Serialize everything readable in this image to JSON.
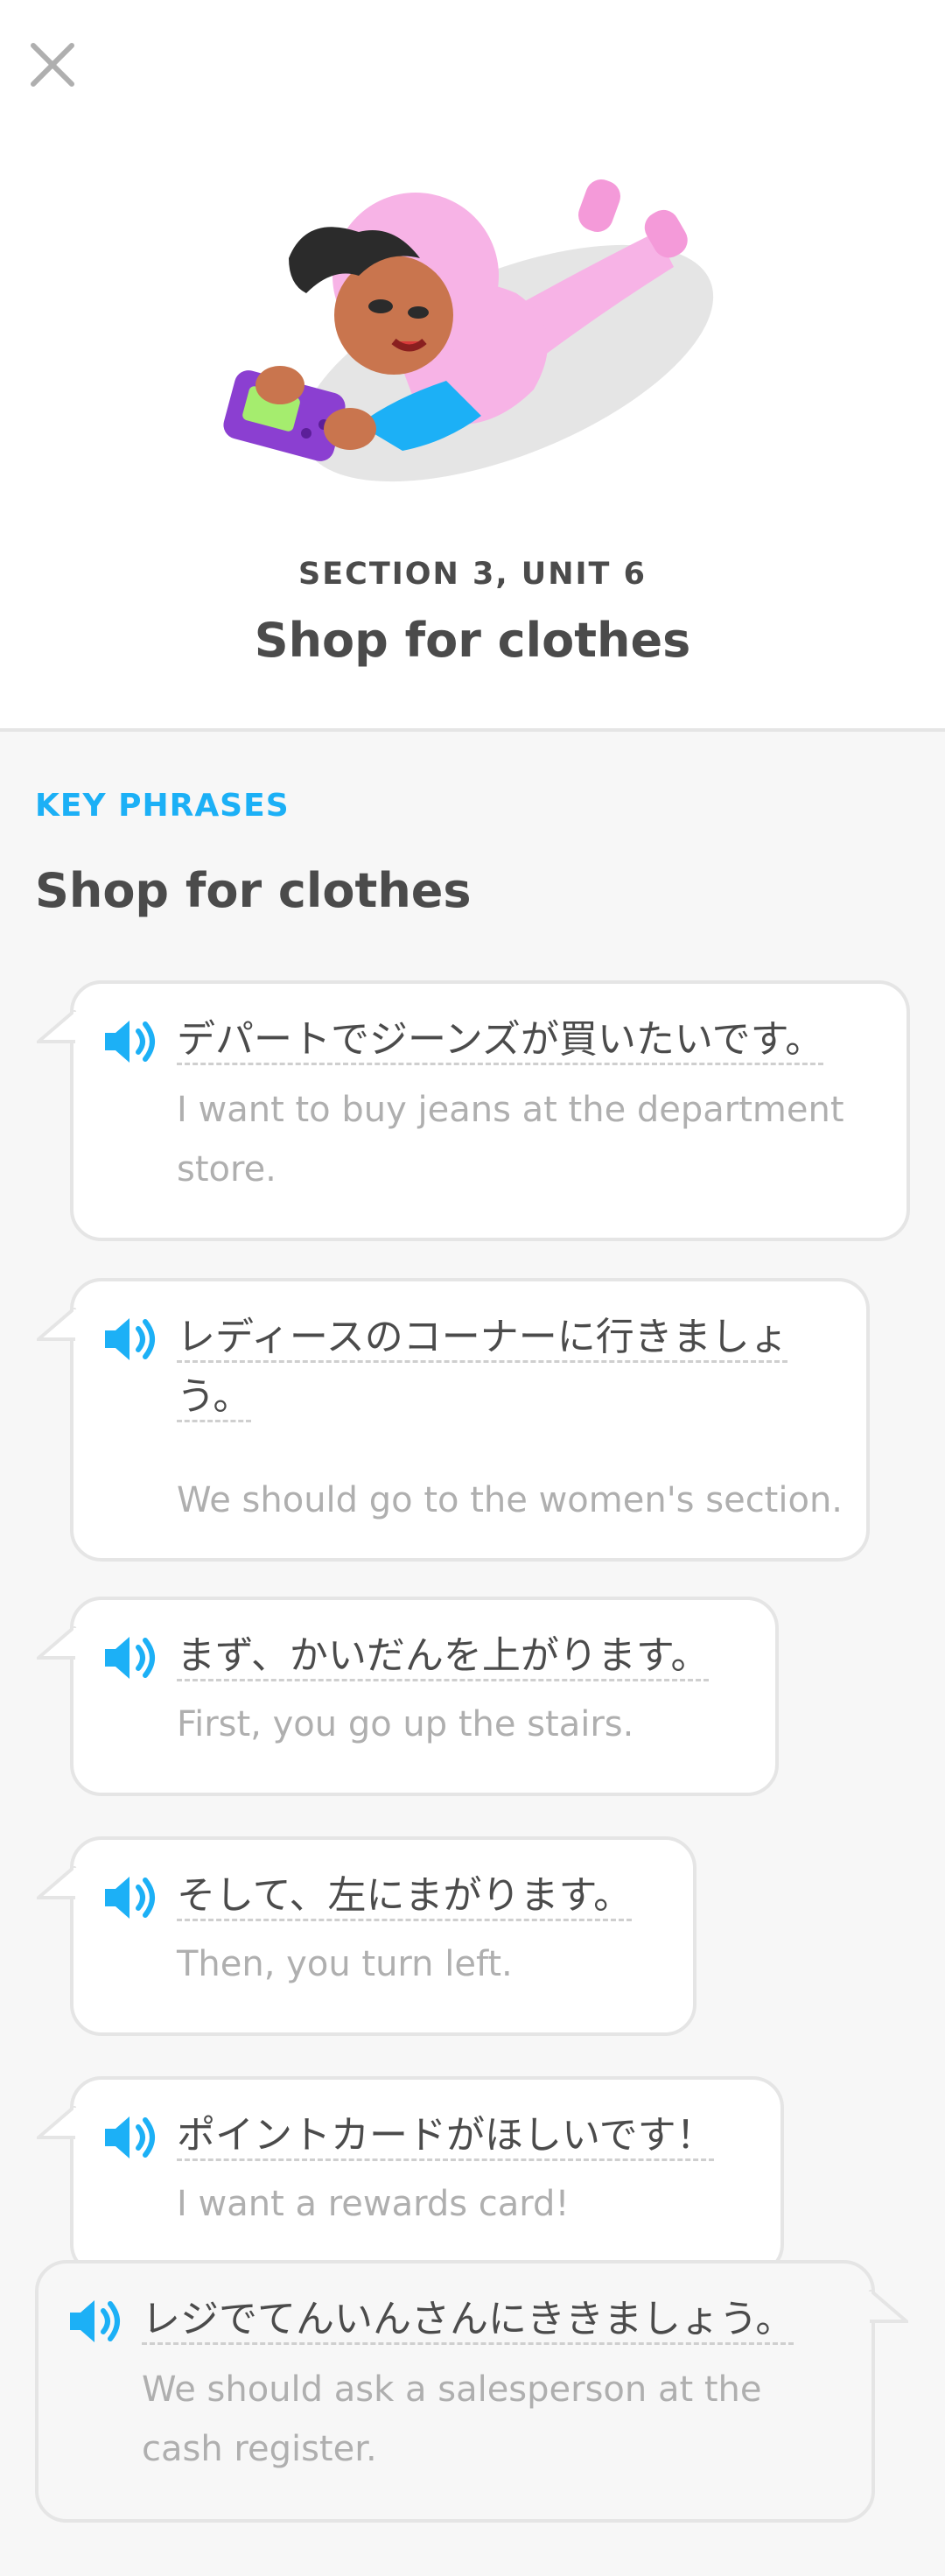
{
  "header": {
    "close_icon": "close-icon",
    "section_label": "SECTION 3, UNIT 6",
    "title": "Shop for clothes"
  },
  "content": {
    "section_label": "KEY PHRASES",
    "title": "Shop for clothes"
  },
  "phrases": [
    {
      "japanese": "デパートでジーンズが買いたいです。",
      "english": "I want to buy jeans at the department\nstore."
    },
    {
      "japanese": "レディースのコーナーに行きましょ\nう。",
      "english": "We should go to the women's section."
    },
    {
      "japanese": "まず、かいだんを上がります。",
      "english": "First, you go up the stairs."
    },
    {
      "japanese": "そして、左にまがります。",
      "english": "Then, you turn left."
    },
    {
      "japanese": "ポイントカードがほしいです！",
      "english": "I want a rewards card!"
    },
    {
      "japanese": "レジでてんいんさんにききましょう。",
      "english": "We should ask a salesperson at the\ncash register."
    }
  ],
  "colors": {
    "accent": "#1cb0f6",
    "text_primary": "#4b4b4b",
    "text_secondary": "#afafaf",
    "border": "#e5e5e5",
    "background": "#f7f7f7"
  }
}
